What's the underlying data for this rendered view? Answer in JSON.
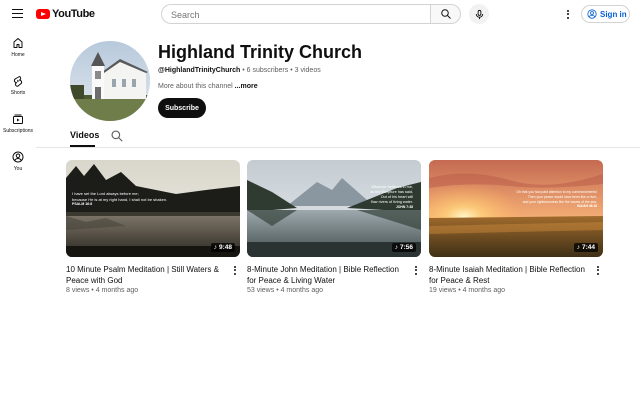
{
  "header": {
    "logo_text": "YouTube",
    "search_placeholder": "Search",
    "signin_label": "Sign in"
  },
  "sidebar": {
    "items": [
      {
        "label": "Home",
        "icon": "home-icon"
      },
      {
        "label": "Shorts",
        "icon": "shorts-icon"
      },
      {
        "label": "Subscriptions",
        "icon": "subscriptions-icon"
      },
      {
        "label": "You",
        "icon": "you-icon"
      }
    ]
  },
  "channel": {
    "name": "Highland Trinity Church",
    "handle": "@HighlandTrinityChurch",
    "subscribers": "6 subscribers",
    "videos_count": "3 videos",
    "about": "More about this channel",
    "more_label": "...more",
    "subscribe_label": "Subscribe"
  },
  "tabs": {
    "videos_label": "Videos"
  },
  "videos": [
    {
      "title": "10 Minute Psalm Meditation | Still Waters & Peace with God",
      "views": "8 views",
      "age": "4 months ago",
      "duration": "9:48",
      "overlay_lines": [
        "I have set the Lord always before me;",
        "because He is at my right hand, I shall not be shaken.",
        "PSALM 16:8"
      ]
    },
    {
      "title": "8-Minute John Meditation | Bible Reflection for Peace & Living Water",
      "views": "53 views",
      "age": "4 months ago",
      "duration": "7:56",
      "overlay_lines": [
        "Whoever believes in me,",
        "as the Scripture has said,",
        "Out of his heart will",
        "flow rivers of living water.",
        "JOHN 7:38"
      ]
    },
    {
      "title": "8-Minute Isaiah Meditation | Bible Reflection for Peace & Rest",
      "views": "19 views",
      "age": "4 months ago",
      "duration": "7:44",
      "overlay_lines": [
        "Oh that you had paid attention to my commandments!",
        "Then your peace would have been like a river,",
        "and your righteousness like the waves of the sea.",
        "ISAIAH 48:18"
      ]
    }
  ],
  "meta_separator": "•",
  "colors": {
    "brand_red": "#ff0000",
    "link_blue": "#065fd4",
    "text_primary": "#0f0f0f",
    "text_secondary": "#606060"
  }
}
